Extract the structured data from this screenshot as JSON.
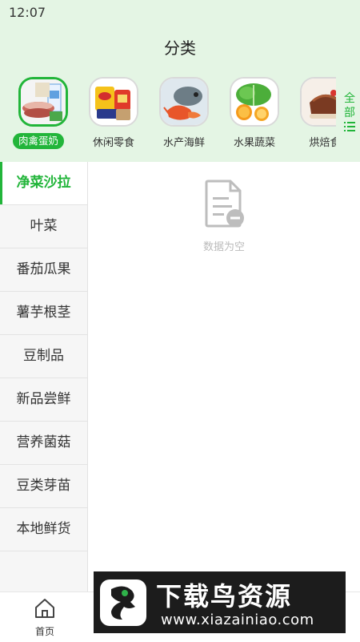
{
  "status_bar": {
    "time": "12:07"
  },
  "header": {
    "title": "分类"
  },
  "categories": [
    {
      "label": "肉禽蛋奶",
      "icon": "meat-eggs-milk-image",
      "active": true
    },
    {
      "label": "休闲零食",
      "icon": "snacks-image",
      "active": false
    },
    {
      "label": "水产海鲜",
      "icon": "seafood-image",
      "active": false
    },
    {
      "label": "水果蔬菜",
      "icon": "fruit-vegetable-image",
      "active": false
    },
    {
      "label": "烘焙食",
      "icon": "bakery-image",
      "active": false
    }
  ],
  "all_button": {
    "line1": "全",
    "line2": "部",
    "icon": "list-icon"
  },
  "sidebar": {
    "items": [
      {
        "label": "净菜沙拉",
        "active": true
      },
      {
        "label": "叶菜"
      },
      {
        "label": "番茄瓜果"
      },
      {
        "label": "薯芋根茎"
      },
      {
        "label": "豆制品"
      },
      {
        "label": "新品尝鲜"
      },
      {
        "label": "营养菌菇"
      },
      {
        "label": "豆类芽苗"
      },
      {
        "label": "本地鲜货"
      }
    ]
  },
  "main": {
    "empty_text": "数据为空",
    "empty_icon": "empty-document-icon"
  },
  "tabbar": {
    "home_label": "首页",
    "home_icon": "home-icon"
  },
  "watermark": {
    "title": "下载鸟资源",
    "url": "www.xiazainiao.com"
  },
  "colors": {
    "accent": "#22b53a",
    "header_bg": "#e4f5e4"
  }
}
